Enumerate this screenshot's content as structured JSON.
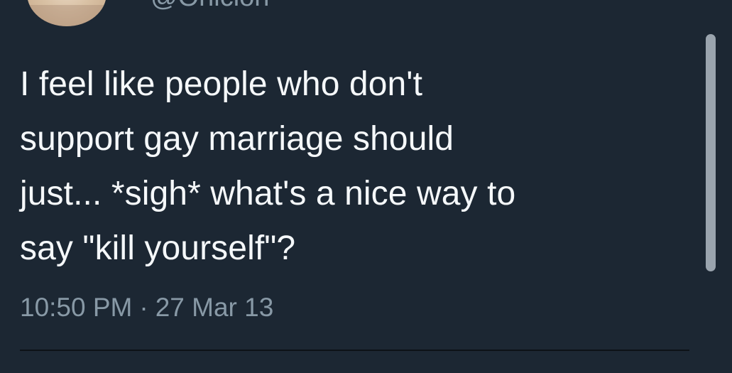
{
  "tweet": {
    "handle": "@Ohicion",
    "text_lines": [
      "I feel like people who don't",
      "support gay marriage should",
      "just... *sigh* what's a nice way to",
      "say \"kill yourself\"?"
    ],
    "time": "10:50 PM",
    "separator": "·",
    "date": "27 Mar 13"
  },
  "colors": {
    "background": "#1c2733",
    "text": "#f5f8fa",
    "secondary_text": "#8899a6"
  }
}
